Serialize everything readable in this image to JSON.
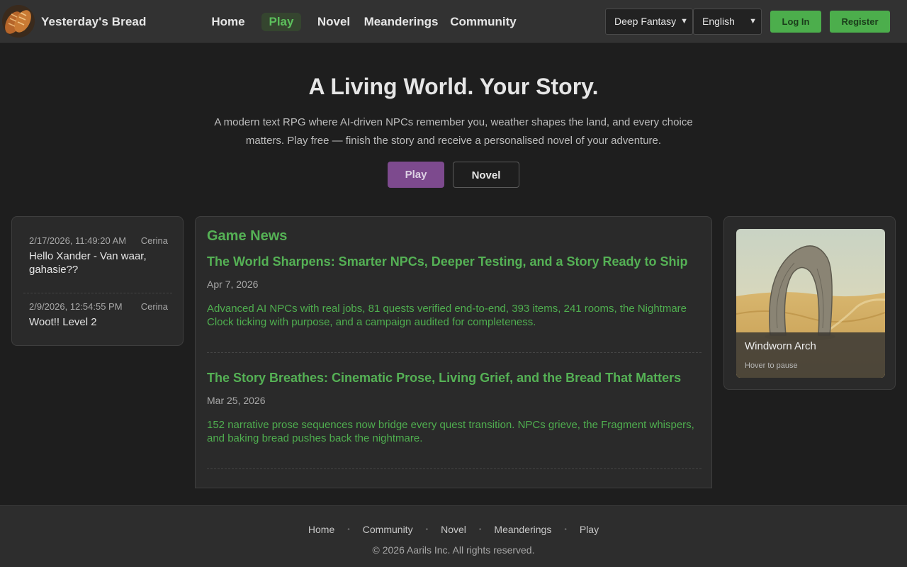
{
  "header": {
    "brand": "Yesterday's Bread",
    "nav": [
      {
        "label": "Home",
        "active": false
      },
      {
        "label": "Play",
        "active": true
      },
      {
        "label": "Novel",
        "active": false
      },
      {
        "label": "Meanderings",
        "active": false
      },
      {
        "label": "Community",
        "active": false
      }
    ],
    "theme_select": "Deep Fantasy",
    "language_select": "English",
    "login_label": "Log In",
    "register_label": "Register"
  },
  "hero": {
    "title": "A Living World. Your Story.",
    "subtitle": "A modern text RPG where AI-driven NPCs remember you, weather shapes the land, and every choice matters. Play free — finish the story and receive a personalised novel of your adventure.",
    "play_label": "Play",
    "novel_label": "Novel"
  },
  "chat": [
    {
      "time": "2/17/2026, 11:49:20 AM",
      "user": "Cerina",
      "message": "Hello Xander - Van waar, gahasie??"
    },
    {
      "time": "2/9/2026, 12:54:55 PM",
      "user": "Cerina",
      "message": "Woot!! Level 2"
    }
  ],
  "news": {
    "heading": "Game News",
    "items": [
      {
        "title": "The World Sharpens: Smarter NPCs, Deeper Testing, and a Story Ready to Ship",
        "date": "Apr 7, 2026",
        "summary": "Advanced AI NPCs with real jobs, 81 quests verified end-to-end, 393 items, 241 rooms, the Nightmare Clock ticking with purpose, and a campaign audited for completeness."
      },
      {
        "title": "The Story Breathes: Cinematic Prose, Living Grief, and the Bread That Matters",
        "date": "Mar 25, 2026",
        "summary": "152 narrative prose sequences now bridge every quest transition. NPCs grieve, the Fragment whispers, and baking bread pushes back the nightmare."
      }
    ]
  },
  "art": {
    "title": "Windworn Arch",
    "hint": "Hover to pause"
  },
  "footer": {
    "links": [
      "Home",
      "Community",
      "Novel",
      "Meanderings",
      "Play"
    ],
    "copyright": "© 2026 Aarils Inc. All rights reserved."
  },
  "colors": {
    "accent_green": "#4cae4c",
    "play_purple": "#7d4a8e",
    "background": "#1e1e1e"
  }
}
